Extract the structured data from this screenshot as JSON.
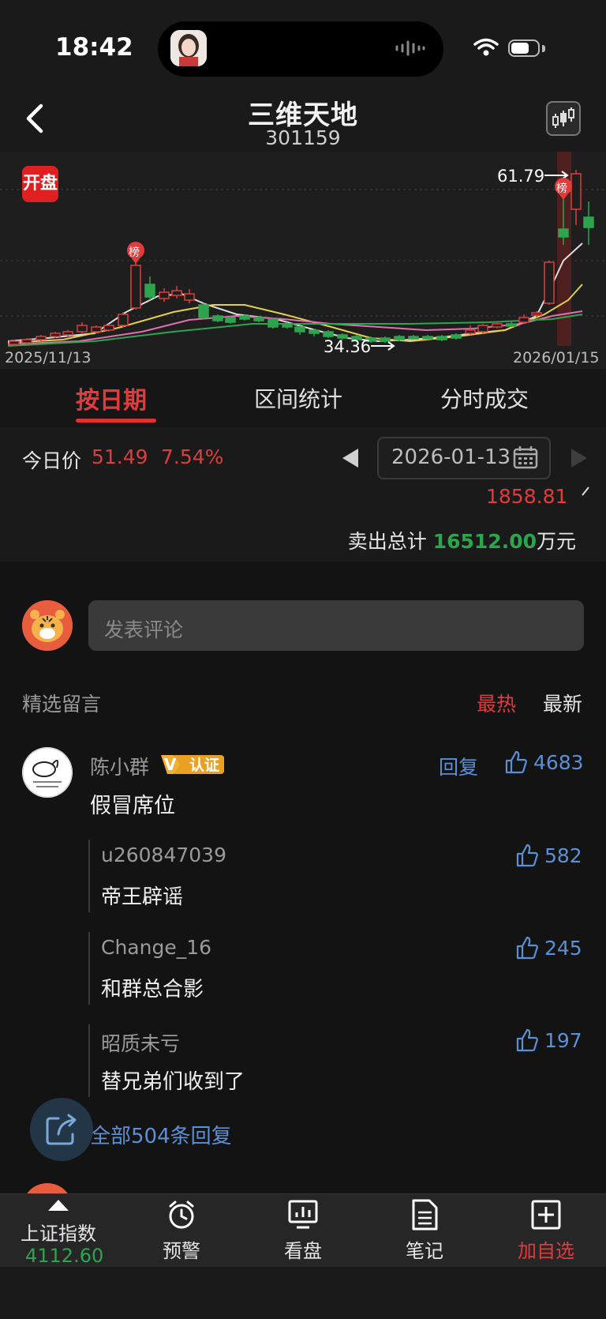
{
  "status_bar": {
    "time": "18:42"
  },
  "header": {
    "title": "三维天地",
    "code": "301159"
  },
  "chart": {
    "badge": "开盘",
    "high_label": "61.79",
    "low_label": "34.36",
    "start_date": "2025/11/13",
    "end_date": "2026/01/15",
    "marker_label": "榜"
  },
  "tabs": [
    "按日期",
    "区间统计",
    "分时成交"
  ],
  "date_row": {
    "today_label": "今日价",
    "today_price": "51.49",
    "today_pct": "7.54%",
    "date": "2026-01-13"
  },
  "sell_summary": {
    "partial_value": "1858.81",
    "label": "卖出总计",
    "value": "16512.00",
    "unit": "万元"
  },
  "comments": {
    "input_placeholder": "发表评论",
    "section_label": "精选留言",
    "sort_hot": "最热",
    "sort_new": "最新",
    "main": {
      "user": "陈小群",
      "badge": "认证",
      "badge_v": "V",
      "reply_label": "回复",
      "likes": "4683",
      "text": "假冒席位"
    },
    "replies": [
      {
        "user": "u260847039",
        "likes": "582",
        "text": "帝王辟谣"
      },
      {
        "user": "Change_16",
        "likes": "245",
        "text": "和群总合影"
      },
      {
        "user": "昭质未亏",
        "likes": "197",
        "text": "替兄弟们收到了"
      }
    ],
    "all_replies": "全部504条回复"
  },
  "bottom_nav": {
    "index_label": "上证指数",
    "index_value": "4112.60",
    "items": [
      "预警",
      "看盘",
      "笔记",
      "加自选"
    ]
  },
  "colors": {
    "up": "#e13b3b",
    "down": "#2ea44f",
    "link": "#5b8fd6"
  }
}
